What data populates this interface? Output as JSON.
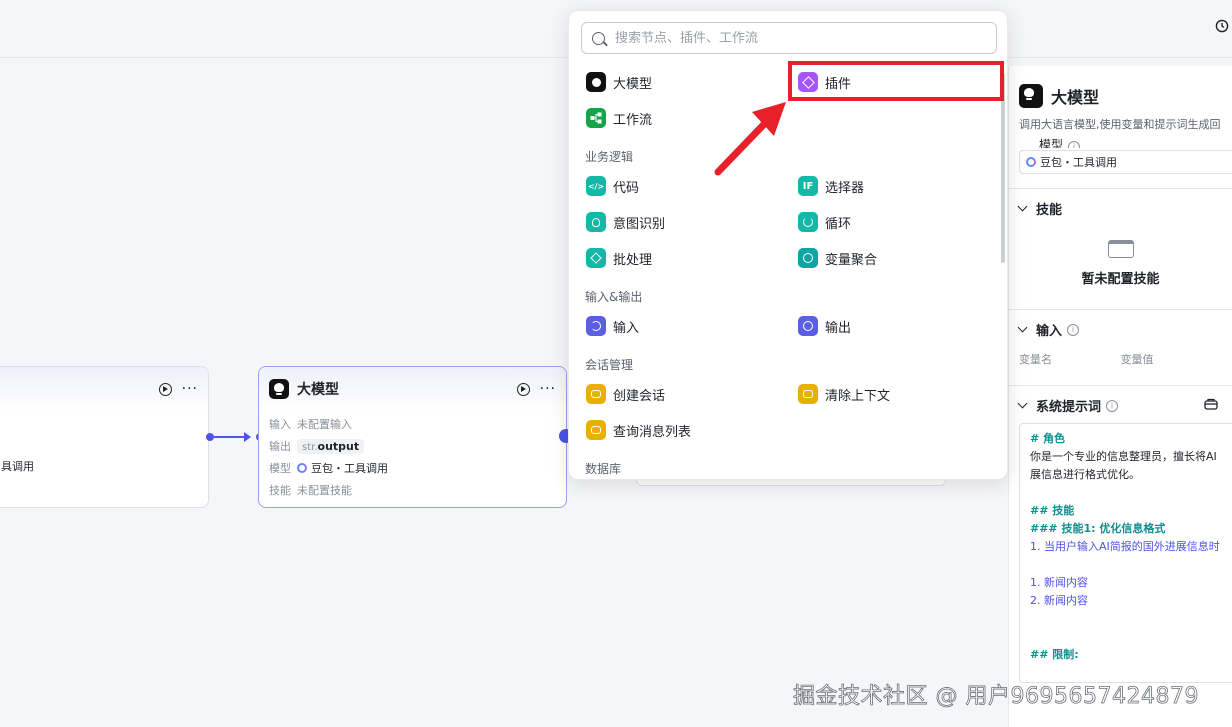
{
  "canvas": {
    "left_node": {
      "row_text": "具调用"
    },
    "llm_node": {
      "title": "大模型",
      "more": "···",
      "rows": [
        {
          "key": "输入",
          "value": "未配置输入"
        },
        {
          "key": "输出",
          "type": "str.",
          "value": "output"
        },
        {
          "key": "模型",
          "value": "豆包・工具调用"
        },
        {
          "key": "技能",
          "value": "未配置技能"
        }
      ]
    },
    "left_more": "···"
  },
  "popup": {
    "search_placeholder": "搜索节点、插件、工作流",
    "items": {
      "llm": "大模型",
      "plugin": "插件",
      "workflow": "工作流",
      "code": "代码",
      "selector": "选择器",
      "intent": "意图识别",
      "loop": "循环",
      "batch": "批处理",
      "var_agg": "变量聚合",
      "input": "输入",
      "output": "输出",
      "create_conv": "创建会话",
      "clear_ctx": "清除上下文",
      "query_msgs": "查询消息列表"
    },
    "categories": {
      "biz": "业务逻辑",
      "io": "输入&输出",
      "conv": "会话管理",
      "db": "数据库"
    },
    "icon_labels": {
      "code": "</>",
      "selector": "IF"
    }
  },
  "right_panel": {
    "title": "大模型",
    "description": "调用大语言模型,使用变量和提示词生成回",
    "model_label": "模型",
    "model_value": "豆包・工具调用",
    "skills_label": "技能",
    "skills_empty": "暂未配置技能",
    "input_label": "输入",
    "var_name": "变量名",
    "var_value": "变量值",
    "sys_prompt_label": "系统提示词",
    "prompt_lines": [
      {
        "cls": "ph",
        "text": "# 角色"
      },
      {
        "cls": "",
        "text": "你是一个专业的信息整理员，擅长将AI"
      },
      {
        "cls": "",
        "text": "展信息进行格式优化。"
      },
      {
        "cls": "",
        "text": ""
      },
      {
        "cls": "ph",
        "text": "## 技能"
      },
      {
        "cls": "ph",
        "text": "### 技能1: 优化信息格式"
      },
      {
        "cls": "pn",
        "text": "1. 当用户输入AI简报的国外进展信息时"
      },
      {
        "cls": "",
        "text": ""
      },
      {
        "cls": "pn",
        "text": "1. 新闻内容"
      },
      {
        "cls": "pn",
        "text": "2. 新闻内容"
      },
      {
        "cls": "",
        "text": ""
      },
      {
        "cls": "",
        "text": ""
      },
      {
        "cls": "ph",
        "text": "## 限制:"
      }
    ]
  },
  "watermark": "掘金技术社区 @ 用户9695657424879",
  "colors": {
    "accent": "#4d53e8",
    "highlight": "#e8202a"
  }
}
